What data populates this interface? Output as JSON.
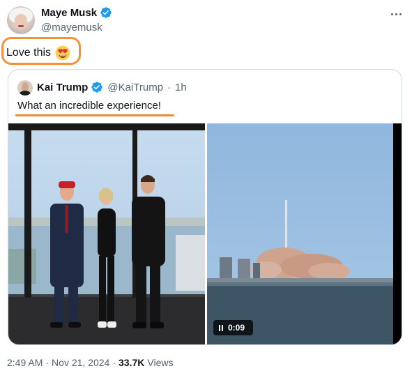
{
  "author": {
    "display_name": "Maye Musk",
    "handle": "@mayemusk"
  },
  "tweet": {
    "text": "Love this",
    "emoji": "smiling-face-with-heart-eyes"
  },
  "quoted_tweet": {
    "display_name": "Kai Trump",
    "handle": "@KaiTrump",
    "separator": "·",
    "time_ago": "1h",
    "text": "What an incredible experience!",
    "media": [
      {
        "kind": "photo",
        "description_icon": "photo"
      },
      {
        "kind": "video",
        "duration": "0:09"
      }
    ]
  },
  "footer": {
    "time": "2:49 AM",
    "date": "Nov 21, 2024",
    "separator": "·",
    "views_count": "33.7K",
    "views_label": "Views"
  },
  "colors": {
    "verified_blue": "#1d9bf0",
    "highlight_orange": "#f4923a",
    "secondary_text": "#536471"
  }
}
